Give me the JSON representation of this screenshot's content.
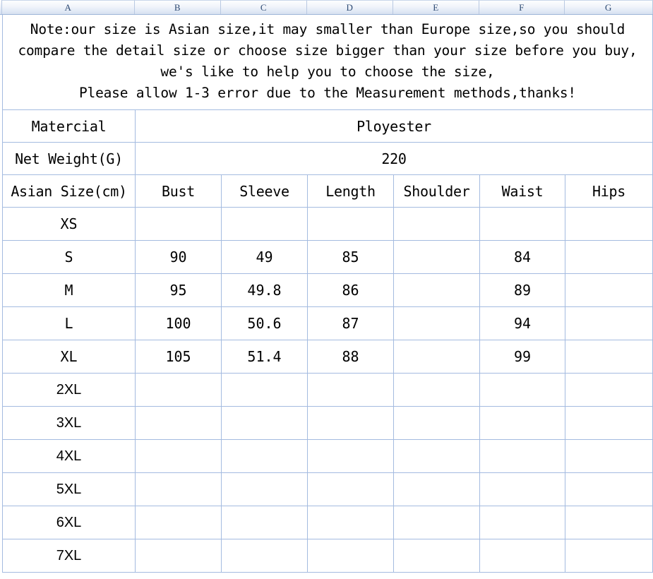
{
  "spreadsheet": {
    "column_headers": [
      "A",
      "B",
      "C",
      "D",
      "E",
      "F",
      "G"
    ]
  },
  "note": {
    "text": "Note:our size is Asian size,it may smaller than Europe size,so you should\ncompare the detail size or choose size bigger than your size before you buy,\nwe's like to help you to choose the size,\nPlease allow 1-3 error due to the Measurement methods,thanks!"
  },
  "info_rows": [
    {
      "label": "Matercial",
      "value": "Ployester"
    },
    {
      "label": "Net Weight(G)",
      "value": "220"
    }
  ],
  "table": {
    "headers": [
      "Asian Size(cm)",
      "Bust",
      "Sleeve",
      "Length",
      "Shoulder",
      "Waist",
      "Hips"
    ],
    "rows": [
      {
        "size": "XS",
        "style": "mono",
        "bust": "",
        "sleeve": "",
        "length": "",
        "shoulder": "",
        "waist": "",
        "hips": ""
      },
      {
        "size": "S",
        "style": "mono",
        "bust": "90",
        "sleeve": "49",
        "length": "85",
        "shoulder": "",
        "waist": "84",
        "hips": ""
      },
      {
        "size": "M",
        "style": "mono",
        "bust": "95",
        "sleeve": "49.8",
        "length": "86",
        "shoulder": "",
        "waist": "89",
        "hips": ""
      },
      {
        "size": "L",
        "style": "mono",
        "bust": "100",
        "sleeve": "50.6",
        "length": "87",
        "shoulder": "",
        "waist": "94",
        "hips": ""
      },
      {
        "size": "XL",
        "style": "mono",
        "bust": "105",
        "sleeve": "51.4",
        "length": "88",
        "shoulder": "",
        "waist": "99",
        "hips": ""
      },
      {
        "size": "2XL",
        "style": "sans",
        "bust": "",
        "sleeve": "",
        "length": "",
        "shoulder": "",
        "waist": "",
        "hips": ""
      },
      {
        "size": "3XL",
        "style": "sans",
        "bust": "",
        "sleeve": "",
        "length": "",
        "shoulder": "",
        "waist": "",
        "hips": ""
      },
      {
        "size": "4XL",
        "style": "sans",
        "bust": "",
        "sleeve": "",
        "length": "",
        "shoulder": "",
        "waist": "",
        "hips": ""
      },
      {
        "size": "5XL",
        "style": "sans",
        "bust": "",
        "sleeve": "",
        "length": "",
        "shoulder": "",
        "waist": "",
        "hips": ""
      },
      {
        "size": "6XL",
        "style": "sans",
        "bust": "",
        "sleeve": "",
        "length": "",
        "shoulder": "",
        "waist": "",
        "hips": ""
      },
      {
        "size": "7XL",
        "style": "sans",
        "bust": "",
        "sleeve": "",
        "length": "",
        "shoulder": "",
        "waist": "",
        "hips": ""
      }
    ]
  },
  "colors": {
    "grid_line": "#a4bbe0",
    "header_text": "#2e4b73",
    "cell_text": "#000000",
    "background": "#ffffff"
  }
}
